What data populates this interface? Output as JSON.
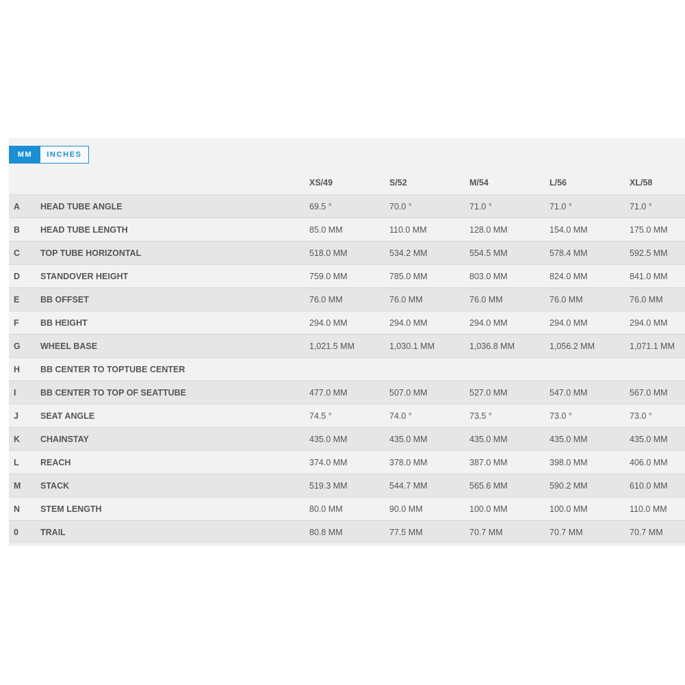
{
  "units": {
    "mm_label": "MM",
    "inches_label": "INCHES",
    "selected": "MM"
  },
  "sizes": [
    "XS/49",
    "S/52",
    "M/54",
    "L/56",
    "XL/58"
  ],
  "rows": [
    {
      "letter": "A",
      "name": "HEAD TUBE ANGLE",
      "values": [
        "69.5 °",
        "70.0 °",
        "71.0 °",
        "71.0 °",
        "71.0 °"
      ]
    },
    {
      "letter": "B",
      "name": "HEAD TUBE LENGTH",
      "values": [
        "85.0 MM",
        "110.0 MM",
        "128.0 MM",
        "154.0 MM",
        "175.0 MM"
      ]
    },
    {
      "letter": "C",
      "name": "TOP TUBE HORIZONTAL",
      "values": [
        "518.0 MM",
        "534.2 MM",
        "554.5 MM",
        "578.4 MM",
        "592.5 MM"
      ]
    },
    {
      "letter": "D",
      "name": "STANDOVER HEIGHT",
      "values": [
        "759.0 MM",
        "785.0 MM",
        "803.0 MM",
        "824.0 MM",
        "841.0 MM"
      ]
    },
    {
      "letter": "E",
      "name": "BB OFFSET",
      "values": [
        "76.0 MM",
        "76.0 MM",
        "76.0 MM",
        "76.0 MM",
        "76.0 MM"
      ]
    },
    {
      "letter": "F",
      "name": "BB HEIGHT",
      "values": [
        "294.0 MM",
        "294.0 MM",
        "294.0 MM",
        "294.0 MM",
        "294.0 MM"
      ]
    },
    {
      "letter": "G",
      "name": "WHEEL BASE",
      "values": [
        "1,021.5 MM",
        "1,030.1 MM",
        "1,036.8 MM",
        "1,056.2 MM",
        "1,071.1 MM"
      ]
    },
    {
      "letter": "H",
      "name": "BB CENTER TO TOPTUBE CENTER",
      "values": [
        "",
        "",
        "",
        "",
        ""
      ]
    },
    {
      "letter": "I",
      "name": "BB CENTER TO TOP OF SEATTUBE",
      "values": [
        "477.0 MM",
        "507.0 MM",
        "527.0 MM",
        "547.0 MM",
        "567.0 MM"
      ]
    },
    {
      "letter": "J",
      "name": "SEAT ANGLE",
      "values": [
        "74.5 °",
        "74.0 °",
        "73.5 °",
        "73.0 °",
        "73.0 °"
      ]
    },
    {
      "letter": "K",
      "name": "CHAINSTAY",
      "values": [
        "435.0 MM",
        "435.0 MM",
        "435.0 MM",
        "435.0 MM",
        "435.0 MM"
      ]
    },
    {
      "letter": "L",
      "name": "REACH",
      "values": [
        "374.0 MM",
        "378.0 MM",
        "387.0 MM",
        "398.0 MM",
        "406.0 MM"
      ]
    },
    {
      "letter": "M",
      "name": "STACK",
      "values": [
        "519.3 MM",
        "544.7 MM",
        "565.6 MM",
        "590.2 MM",
        "610.0 MM"
      ]
    },
    {
      "letter": "N",
      "name": "STEM LENGTH",
      "values": [
        "80.0 MM",
        "90.0 MM",
        "100.0 MM",
        "100.0 MM",
        "110.0 MM"
      ]
    },
    {
      "letter": "0",
      "name": "TRAIL",
      "values": [
        "80.8 MM",
        "77.5 MM",
        "70.7 MM",
        "70.7 MM",
        "70.7 MM"
      ]
    }
  ],
  "colors": {
    "accent": "#1a8fd4",
    "panel_bg": "#f2f2f2",
    "row_alt": "#e6e6e6",
    "text": "#555555"
  }
}
